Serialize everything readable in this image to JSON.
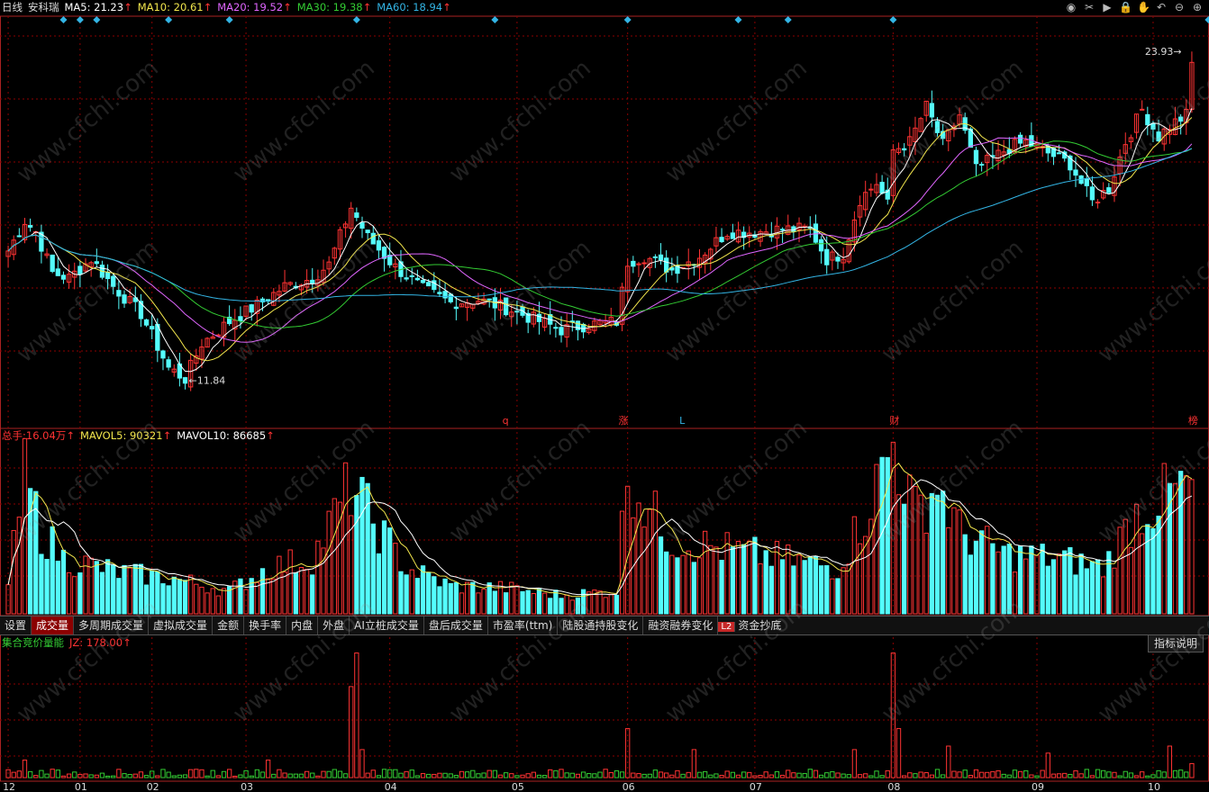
{
  "stock": {
    "period": "日线",
    "name": "安科瑞"
  },
  "ma": [
    {
      "label": "MA5:",
      "value": "21.23",
      "arrow": "↑",
      "color": "#ffffff"
    },
    {
      "label": "MA10:",
      "value": "20.61",
      "arrow": "↑",
      "color": "#f2e64d"
    },
    {
      "label": "MA20:",
      "value": "19.52",
      "arrow": "↑",
      "color": "#e066ff"
    },
    {
      "label": "MA30:",
      "value": "19.38",
      "arrow": "↑",
      "color": "#33cc33"
    },
    {
      "label": "MA60:",
      "value": "18.94",
      "arrow": "↑",
      "color": "#33b5e5"
    }
  ],
  "volume_header": {
    "total_label": "总手:",
    "total_value": "16.04万",
    "total_arrow": "↑",
    "mavol5_label": "MAVOL5:",
    "mavol5_value": "90321",
    "mavol5_arrow": "↑",
    "mavol10_label": "MAVOL10:",
    "mavol10_value": "86685",
    "mavol10_arrow": "↑"
  },
  "indicator_header": {
    "name": "集合竞价量能",
    "jz_label": "JZ:",
    "jz_value": "178.00",
    "jz_arrow": "↑"
  },
  "tabs": [
    "设置",
    "成交量",
    "多周期成交量",
    "虚拟成交量",
    "金额",
    "换手率",
    "内盘",
    "外盘",
    "AI立桩成交量",
    "盘后成交量",
    "市盈率(ttm)",
    "陆股通持股变化",
    "融资融券变化",
    "资金抄底"
  ],
  "active_tab": "成交量",
  "l2_badge": "L2",
  "help_button": "指标说明",
  "toolbar_icons": [
    "eye-icon",
    "scissors-icon",
    "play-icon",
    "lock-icon",
    "hand-icon",
    "undo-icon",
    "zoom-out-icon",
    "zoom-in-icon"
  ],
  "toolbar_glyphs": [
    "◉",
    "✂",
    "▶",
    "🔒",
    "✋",
    "↶",
    "⊖",
    "⊕"
  ],
  "watermark": "www.cfchi.com",
  "colors": {
    "up": "#ff3333",
    "down": "#54fcfc",
    "grid": "#8b0000",
    "axis": "#aa2222",
    "ma5": "#ffffff",
    "ma10": "#f2e64d",
    "ma20": "#e066ff",
    "ma30": "#33cc33",
    "ma60": "#33b5e5"
  },
  "chart_data": {
    "type": "candlestick",
    "price_high_label": "23.93",
    "price_low_label": "11.84",
    "price_ylim": [
      11.0,
      24.5
    ],
    "months": [
      {
        "label": "12",
        "index": 0
      },
      {
        "label": "01",
        "index": 13
      },
      {
        "label": "02",
        "index": 26
      },
      {
        "label": "03",
        "index": 43
      },
      {
        "label": "04",
        "index": 69
      },
      {
        "label": "05",
        "index": 92
      },
      {
        "label": "06",
        "index": 112
      },
      {
        "label": "07",
        "index": 135
      },
      {
        "label": "08",
        "index": 160
      },
      {
        "label": "09",
        "index": 186
      },
      {
        "label": "10",
        "index": 207
      }
    ],
    "event_markers": [
      {
        "label": "q",
        "index": 90,
        "color": "#ff3333"
      },
      {
        "label": "涨",
        "index": 111,
        "color": "#ff3333"
      },
      {
        "label": "L",
        "index": 122,
        "color": "#33b5e5"
      },
      {
        "label": "财",
        "index": 160,
        "color": "#ff3333"
      },
      {
        "label": "榜",
        "index": 214,
        "color": "#ff3333"
      }
    ],
    "diamond_marks": [
      10,
      13,
      16,
      29,
      40,
      63,
      88,
      112,
      132,
      141,
      160,
      217
    ],
    "close_anchors": [
      [
        0,
        16.6
      ],
      [
        3,
        17.7
      ],
      [
        5,
        17.3
      ],
      [
        8,
        15.8
      ],
      [
        11,
        15.6
      ],
      [
        15,
        16.3
      ],
      [
        19,
        15.3
      ],
      [
        24,
        14.3
      ],
      [
        29,
        12.3
      ],
      [
        32,
        11.9
      ],
      [
        35,
        13.2
      ],
      [
        40,
        14.0
      ],
      [
        45,
        14.6
      ],
      [
        50,
        15.3
      ],
      [
        55,
        15.6
      ],
      [
        58,
        16.1
      ],
      [
        62,
        18.2
      ],
      [
        65,
        17.1
      ],
      [
        70,
        16.0
      ],
      [
        75,
        15.2
      ],
      [
        80,
        14.7
      ],
      [
        85,
        14.8
      ],
      [
        90,
        14.5
      ],
      [
        95,
        14.1
      ],
      [
        100,
        13.7
      ],
      [
        105,
        13.9
      ],
      [
        110,
        14.0
      ],
      [
        112,
        16.2
      ],
      [
        115,
        16.4
      ],
      [
        120,
        15.9
      ],
      [
        125,
        16.4
      ],
      [
        130,
        17.3
      ],
      [
        135,
        17.3
      ],
      [
        140,
        17.4
      ],
      [
        145,
        17.4
      ],
      [
        148,
        16.3
      ],
      [
        151,
        16.5
      ],
      [
        154,
        18.5
      ],
      [
        157,
        19.1
      ],
      [
        159,
        18.3
      ],
      [
        160,
        20.3
      ],
      [
        163,
        20.6
      ],
      [
        166,
        21.9
      ],
      [
        169,
        20.5
      ],
      [
        172,
        21.6
      ],
      [
        175,
        19.6
      ],
      [
        178,
        20.0
      ],
      [
        181,
        20.4
      ],
      [
        184,
        20.6
      ],
      [
        188,
        20.2
      ],
      [
        192,
        19.8
      ],
      [
        196,
        18.4
      ],
      [
        199,
        18.9
      ],
      [
        202,
        20.6
      ],
      [
        205,
        21.8
      ],
      [
        208,
        20.8
      ],
      [
        210,
        21.2
      ],
      [
        213,
        21.6
      ],
      [
        214,
        23.93
      ]
    ],
    "volume_ylim": [
      0,
      190000
    ],
    "volume_anchors": [
      [
        0,
        30000
      ],
      [
        3,
        150000
      ],
      [
        6,
        90000
      ],
      [
        10,
        60000
      ],
      [
        20,
        45000
      ],
      [
        30,
        38000
      ],
      [
        40,
        25000
      ],
      [
        47,
        50000
      ],
      [
        55,
        60000
      ],
      [
        62,
        140000
      ],
      [
        66,
        100000
      ],
      [
        72,
        50000
      ],
      [
        80,
        30000
      ],
      [
        90,
        28000
      ],
      [
        100,
        20000
      ],
      [
        110,
        25000
      ],
      [
        112,
        160000
      ],
      [
        115,
        120000
      ],
      [
        120,
        80000
      ],
      [
        130,
        70000
      ],
      [
        140,
        60000
      ],
      [
        150,
        50000
      ],
      [
        155,
        110000
      ],
      [
        160,
        185000
      ],
      [
        164,
        110000
      ],
      [
        168,
        140000
      ],
      [
        172,
        90000
      ],
      [
        180,
        65000
      ],
      [
        190,
        60000
      ],
      [
        198,
        50000
      ],
      [
        204,
        110000
      ],
      [
        210,
        130000
      ],
      [
        214,
        140000
      ]
    ],
    "jz_ylim": [
      0,
      180
    ],
    "jz_spikes": [
      [
        3,
        25
      ],
      [
        8,
        12
      ],
      [
        47,
        25
      ],
      [
        62,
        130
      ],
      [
        63,
        178
      ],
      [
        64,
        40
      ],
      [
        112,
        70
      ],
      [
        124,
        40
      ],
      [
        153,
        40
      ],
      [
        160,
        178
      ],
      [
        161,
        70
      ],
      [
        170,
        45
      ],
      [
        188,
        35
      ],
      [
        210,
        45
      ],
      [
        214,
        20
      ]
    ],
    "candle_count": 215
  }
}
